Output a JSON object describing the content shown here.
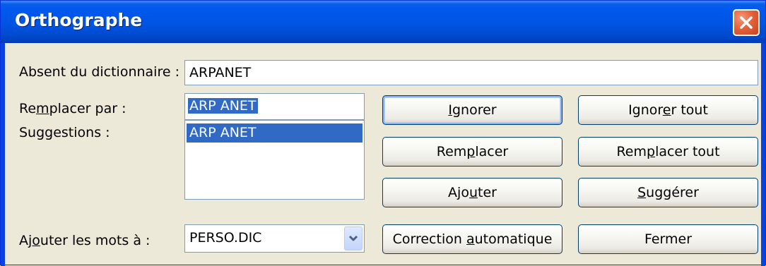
{
  "window": {
    "title": "Orthographe"
  },
  "labels": {
    "absent": "Absent du dictionnaire :",
    "replace_by_pre": "Re",
    "replace_by_acc": "m",
    "replace_by_post": "placer par :",
    "suggestions": "Suggestions :",
    "add_words_pre": "Aj",
    "add_words_acc": "o",
    "add_words_post": "uter les mots à :"
  },
  "fields": {
    "absent_word": "ARPANET",
    "replace_value": "ARP ANET",
    "suggestions": [
      "ARP ANET"
    ],
    "dictionary": "PERSO.DIC"
  },
  "buttons": {
    "ignore": {
      "pre": "",
      "acc": "I",
      "post": "gnorer"
    },
    "ignore_all": {
      "pre": "Ignor",
      "acc": "e",
      "post": "r tout"
    },
    "replace": {
      "pre": "Rem",
      "acc": "p",
      "post": "lacer"
    },
    "replace_all": {
      "pre": "Rem",
      "acc": "p",
      "post": "lacer tout"
    },
    "add": {
      "pre": "Ajo",
      "acc": "u",
      "post": "ter"
    },
    "suggest": {
      "pre": "",
      "acc": "S",
      "post": "uggérer"
    },
    "autocorrect": {
      "pre": "Correction ",
      "acc": "a",
      "post": "utomatique"
    },
    "close": {
      "pre": "Fermer",
      "acc": "",
      "post": ""
    }
  }
}
